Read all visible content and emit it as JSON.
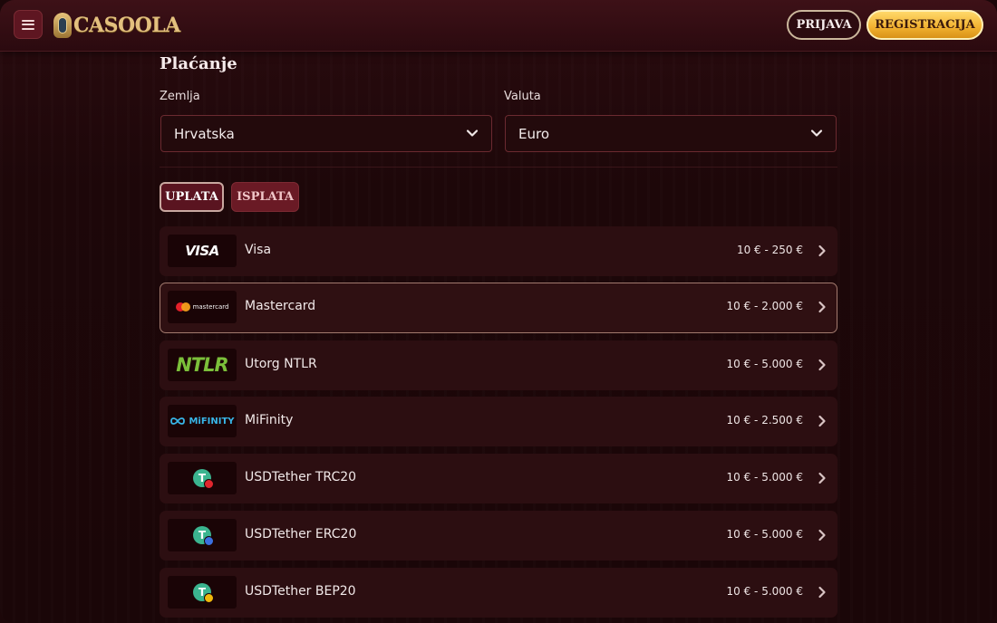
{
  "header": {
    "brand": "CASOOLA",
    "login_label": "PRIJAVA",
    "register_label": "REGISTRACIJA"
  },
  "page": {
    "title": "Plaćanje",
    "country": {
      "label": "Zemlja",
      "value": "Hrvatska"
    },
    "currency": {
      "label": "Valuta",
      "value": "Euro"
    },
    "tabs": [
      {
        "label": "UPLATA",
        "active": true
      },
      {
        "label": "ISPLATA",
        "active": false
      }
    ]
  },
  "methods": [
    {
      "name": "Visa",
      "range": "10 € - 250 €",
      "logo_text": "VISA",
      "icon": "visa-logo"
    },
    {
      "name": "Mastercard",
      "range": "10 € - 2.000 €",
      "logo_text": "mastercard",
      "icon": "mastercard-logo",
      "selected": true
    },
    {
      "name": "Utorg NTLR",
      "range": "10 € - 5.000 €",
      "logo_text": "NTLR",
      "icon": "ntlr-logo"
    },
    {
      "name": "MiFinity",
      "range": "10 € - 2.500 €",
      "logo_text": "MiFINITY",
      "icon": "mifinity-logo"
    },
    {
      "name": "USDTether TRC20",
      "range": "10 € - 5.000 €",
      "icon": "tether-trc20-icon",
      "badge_color": "#e0262e"
    },
    {
      "name": "USDTether ERC20",
      "range": "10 € - 5.000 €",
      "icon": "tether-erc20-icon",
      "badge_color": "#3a6fe0"
    },
    {
      "name": "USDTether BEP20",
      "range": "10 € - 5.000 €",
      "icon": "tether-bep20-icon",
      "badge_color": "#f0b90b"
    }
  ],
  "colors": {
    "accent_gold": "#f1b02f",
    "row_bg": "#2c0e11",
    "tether_green": "#3bb48f"
  }
}
